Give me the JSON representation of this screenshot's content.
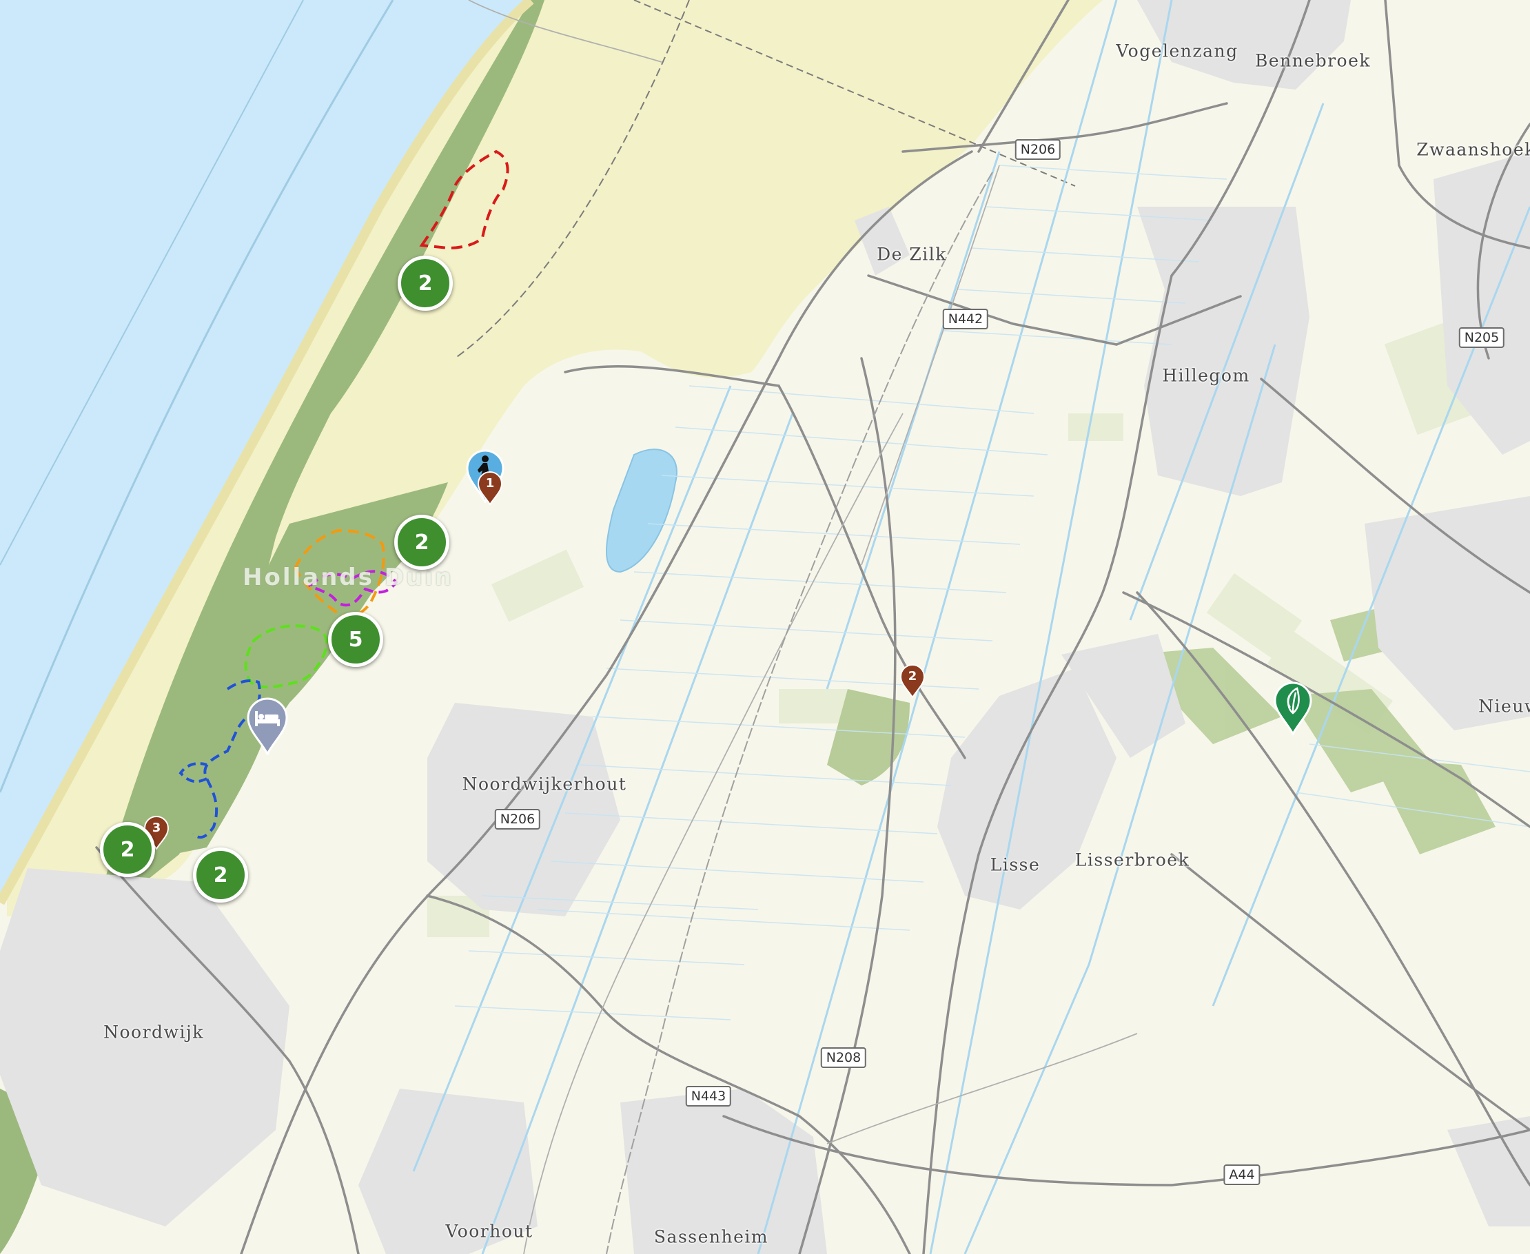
{
  "colors": {
    "sea": "#cbe9fa",
    "dunes": "#f3f1c7",
    "forest": "#9cb97d",
    "land": "#f7f6ea",
    "road": "#8e8e8e",
    "water_line": "#a9d7ef",
    "cluster": "#3f8f2f",
    "poi_brown": "#8b3a1d",
    "poi_blue": "#58aee0",
    "poi_gray": "#8f9bb8",
    "poi_green": "#1f8d4c"
  },
  "places": {
    "vogelenzang": "Vogelenzang",
    "bennebroek": "Bennebroek",
    "zwaanshoek": "Zwaanshoek",
    "de_zilk": "De Zilk",
    "hillegom": "Hillegom",
    "nieuw": "Nieuw",
    "noordwijkerhout": "Noordwijkerhout",
    "lisse": "Lisse",
    "lisserbroek": "Lisserbroek",
    "noordwijk": "Noordwijk",
    "voorhout": "Voorhout",
    "sassenheim": "Sassenheim"
  },
  "region_label": "Hollands Duin",
  "roads": {
    "n206_north": "N206",
    "n442": "N442",
    "n205": "N205",
    "n206_south": "N206",
    "n208": "N208",
    "n443": "N443",
    "a44": "A44"
  },
  "clusters": {
    "north": "2",
    "middle": "2",
    "five": "5",
    "southwest": "2",
    "south": "2"
  },
  "pois": {
    "brown_1": {
      "label": "1",
      "icon": "map-pin-icon"
    },
    "brown_2": {
      "label": "2",
      "icon": "map-pin-icon"
    },
    "brown_3": {
      "label": "3",
      "icon": "map-pin-icon"
    },
    "activity": {
      "icon": "walking-person-icon"
    },
    "lodging": {
      "icon": "bed-icon"
    },
    "nature": {
      "icon": "leaf-icon"
    }
  }
}
